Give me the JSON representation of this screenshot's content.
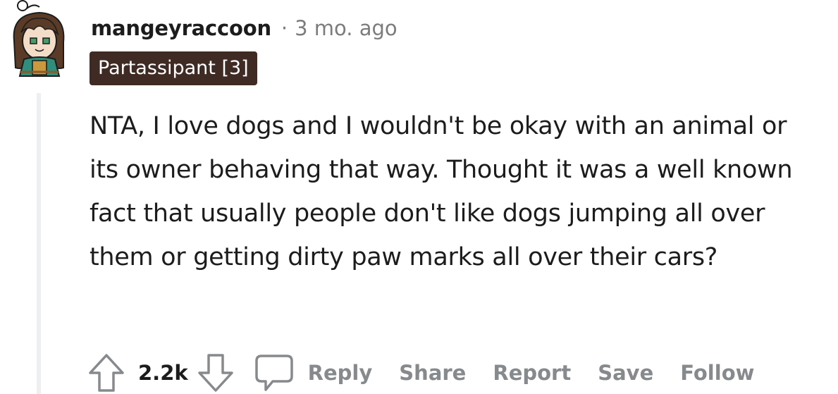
{
  "comment": {
    "author": "mangeyraccoon",
    "separator": "·",
    "timestamp": "3 mo. ago",
    "flair": "Partassipant [3]",
    "body": "NTA, I love dogs and I wouldn't be okay with an animal or its owner behaving that way. Thought it was a well known fact that usually people don't like dogs jumping all over them or getting dirty paw marks all over their cars?",
    "score": "2.2k"
  },
  "actions": {
    "reply": "Reply",
    "share": "Share",
    "report": "Report",
    "save": "Save",
    "follow": "Follow"
  },
  "icons": {
    "avatar": "avatar-icon",
    "upvote": "upvote-arrow-icon",
    "downvote": "downvote-arrow-icon",
    "reply": "speech-bubble-icon"
  },
  "colors": {
    "flair_bg": "#3f2a24",
    "muted": "#878a8c",
    "thread_line": "#edeff1"
  }
}
